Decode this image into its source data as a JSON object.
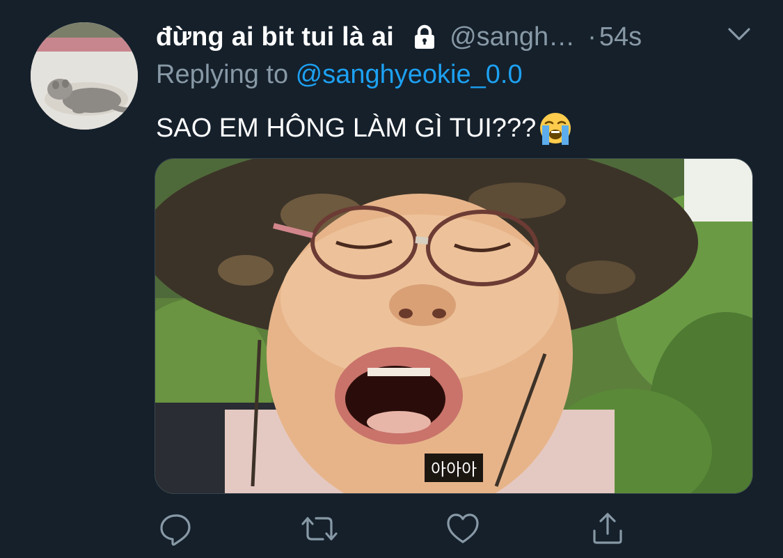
{
  "author": {
    "display_name": "đừng ai bit tui là ai",
    "handle": "@sangh…",
    "separator": "·",
    "timestamp": "54s",
    "protected_icon": "lock-icon"
  },
  "reply": {
    "prefix": "Replying to ",
    "mention": "@sanghyeokie_0.0"
  },
  "tweet": {
    "text": "SAO EM HÔNG LÀM GÌ TUI???",
    "emoji": "loudly-crying-face-emoji"
  },
  "media": {
    "subtitle": "아아아"
  },
  "actions": {
    "reply_icon": "reply-icon",
    "retweet_icon": "retweet-icon",
    "like_icon": "like-icon",
    "share_icon": "share-icon"
  },
  "colors": {
    "background": "#15202b",
    "primary_text": "#ffffff",
    "secondary_text": "#8899a6",
    "accent": "#1da1f2"
  }
}
